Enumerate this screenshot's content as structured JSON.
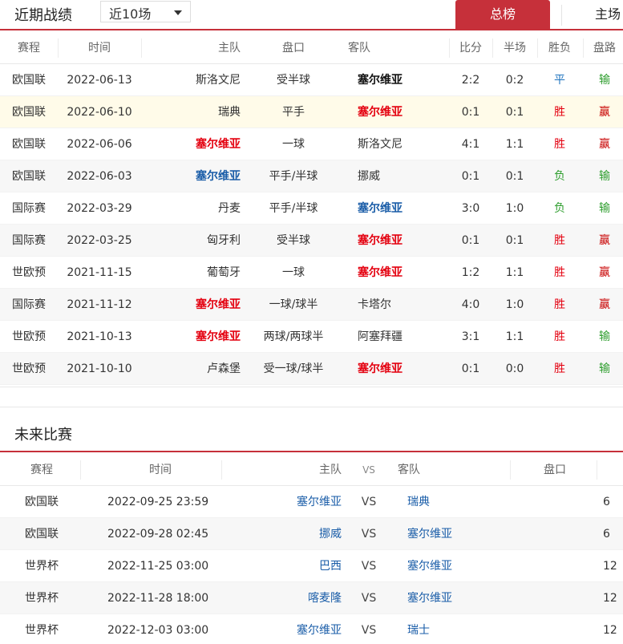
{
  "recent": {
    "title": "近期战绩",
    "range": "近10场",
    "tabs": {
      "total": "总榜",
      "home": "主场"
    },
    "columns": [
      "赛程",
      "时间",
      "主队",
      "盘口",
      "客队",
      "比分",
      "半场",
      "胜负",
      "盘路"
    ],
    "rows": [
      {
        "comp": "欧国联",
        "date": "2022-06-13",
        "home": "斯洛文尼",
        "home_style": "plain",
        "handicap": "受半球",
        "away": "塞尔维亚",
        "away_style": "bold",
        "score": "2:2",
        "half": "0:2",
        "result": "平",
        "pan": "输"
      },
      {
        "comp": "欧国联",
        "date": "2022-06-10",
        "home": "瑞典",
        "home_style": "plain",
        "handicap": "平手",
        "away": "塞尔维亚",
        "away_style": "red",
        "score": "0:1",
        "half": "0:1",
        "result": "胜",
        "pan": "赢"
      },
      {
        "comp": "欧国联",
        "date": "2022-06-06",
        "home": "塞尔维亚",
        "home_style": "red",
        "handicap": "一球",
        "away": "斯洛文尼",
        "away_style": "plain",
        "score": "4:1",
        "half": "1:1",
        "result": "胜",
        "pan": "赢"
      },
      {
        "comp": "欧国联",
        "date": "2022-06-03",
        "home": "塞尔维亚",
        "home_style": "blue",
        "handicap": "平手/半球",
        "away": "挪威",
        "away_style": "plain",
        "score": "0:1",
        "half": "0:1",
        "result": "负",
        "pan": "输"
      },
      {
        "comp": "国际赛",
        "date": "2022-03-29",
        "home": "丹麦",
        "home_style": "plain",
        "handicap": "平手/半球",
        "away": "塞尔维亚",
        "away_style": "blue",
        "score": "3:0",
        "half": "1:0",
        "result": "负",
        "pan": "输"
      },
      {
        "comp": "国际赛",
        "date": "2022-03-25",
        "home": "匈牙利",
        "home_style": "plain",
        "handicap": "受半球",
        "away": "塞尔维亚",
        "away_style": "red",
        "score": "0:1",
        "half": "0:1",
        "result": "胜",
        "pan": "赢"
      },
      {
        "comp": "世欧预",
        "date": "2021-11-15",
        "home": "葡萄牙",
        "home_style": "plain",
        "handicap": "一球",
        "away": "塞尔维亚",
        "away_style": "red",
        "score": "1:2",
        "half": "1:1",
        "result": "胜",
        "pan": "赢"
      },
      {
        "comp": "国际赛",
        "date": "2021-11-12",
        "home": "塞尔维亚",
        "home_style": "red",
        "handicap": "一球/球半",
        "away": "卡塔尔",
        "away_style": "plain",
        "score": "4:0",
        "half": "1:0",
        "result": "胜",
        "pan": "赢"
      },
      {
        "comp": "世欧预",
        "date": "2021-10-13",
        "home": "塞尔维亚",
        "home_style": "red",
        "handicap": "两球/两球半",
        "away": "阿塞拜疆",
        "away_style": "plain",
        "score": "3:1",
        "half": "1:1",
        "result": "胜",
        "pan": "输"
      },
      {
        "comp": "世欧预",
        "date": "2021-10-10",
        "home": "卢森堡",
        "home_style": "plain",
        "handicap": "受一球/球半",
        "away": "塞尔维亚",
        "away_style": "red",
        "score": "0:1",
        "half": "0:0",
        "result": "胜",
        "pan": "输"
      }
    ]
  },
  "future": {
    "title": "未来比赛",
    "columns": [
      "赛程",
      "时间",
      "主队",
      "VS",
      "客队",
      "盘口"
    ],
    "rows": [
      {
        "comp": "欧国联",
        "time": "2022-09-25 23:59",
        "home": "塞尔维亚",
        "vs": "VS",
        "away": "瑞典",
        "extra": "6"
      },
      {
        "comp": "欧国联",
        "time": "2022-09-28 02:45",
        "home": "挪威",
        "vs": "VS",
        "away": "塞尔维亚",
        "extra": "6"
      },
      {
        "comp": "世界杯",
        "time": "2022-11-25 03:00",
        "home": "巴西",
        "vs": "VS",
        "away": "塞尔维亚",
        "extra": "12"
      },
      {
        "comp": "世界杯",
        "time": "2022-11-28 18:00",
        "home": "喀麦隆",
        "vs": "VS",
        "away": "塞尔维亚",
        "extra": "12"
      },
      {
        "comp": "世界杯",
        "time": "2022-12-03 03:00",
        "home": "塞尔维亚",
        "vs": "VS",
        "away": "瑞士",
        "extra": "12"
      }
    ]
  },
  "colors": {
    "accent": "#c6303a",
    "win": "#e4000f",
    "draw": "#1e73be",
    "lose": "#2f9e2f",
    "team_blue": "#1a5da8",
    "highlight_row": "#fffbe9"
  },
  "icons": {
    "range_dropdown": "caret-down-icon"
  }
}
